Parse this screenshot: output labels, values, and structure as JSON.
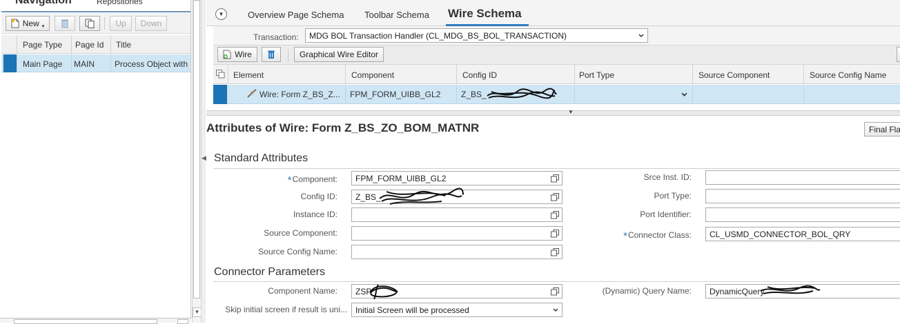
{
  "navigation": {
    "title": "Navigation",
    "repositories_tab": "Repositories",
    "toolbar": {
      "new": "New",
      "up": "Up",
      "down": "Down"
    },
    "columns": [
      "Page Type",
      "Page Id",
      "Title"
    ],
    "rows": [
      {
        "page_type": "Main Page",
        "page_id": "MAIN",
        "title": "Process Object with"
      }
    ]
  },
  "tabs": {
    "overview": "Overview Page Schema",
    "toolbar": "Toolbar Schema",
    "wire": "Wire Schema"
  },
  "transaction": {
    "label": "Transaction:",
    "value": "MDG BOL Transaction Handler (CL_MDG_BS_BOL_TRANSACTION)"
  },
  "wire_toolbar": {
    "wire": "Wire",
    "editor": "Graphical Wire Editor"
  },
  "wire_grid": {
    "columns": [
      "Element",
      "Component",
      "Config ID",
      "Port Type",
      "Source Component",
      "Source Config Name"
    ],
    "rows": [
      {
        "element": "Wire: Form Z_BS_Z...",
        "component": "FPM_FORM_UIBB_GL2",
        "config_id": "Z_BS_",
        "port_type": "",
        "source_component": "",
        "source_config_name": ""
      }
    ]
  },
  "attributes": {
    "title": "Attributes of Wire: Form Z_BS_ZO_BOM_MATNR",
    "final_flag_button": "Final Fla",
    "standard": {
      "title": "Standard Attributes",
      "component_label": "Component:",
      "component_value": "FPM_FORM_UIBB_GL2",
      "config_id_label": "Config ID:",
      "config_id_value": "Z_BS_",
      "instance_id_label": "Instance ID:",
      "instance_id_value": "",
      "source_component_label": "Source Component:",
      "source_component_value": "",
      "source_config_name_label": "Source Config Name:",
      "source_config_name_value": "",
      "srce_inst_label": "Srce Inst. ID:",
      "srce_inst_value": "",
      "port_type_label": "Port Type:",
      "port_type_value": "",
      "port_identifier_label": "Port Identifier:",
      "port_identifier_value": "",
      "connector_class_label": "Connector Class:",
      "connector_class_value": "CL_USMD_CONNECTOR_BOL_QRY"
    },
    "connector": {
      "title": "Connector Parameters",
      "component_name_label": "Component Name:",
      "component_name_value": "ZSP",
      "skip_label": "Skip initial screen if result is uni...",
      "skip_value": "Initial Screen will be processed",
      "query_name_label": "(Dynamic) Query Name:",
      "query_name_value": "DynamicQuery"
    }
  },
  "colors": {
    "selection": "#cfe6f5",
    "accent": "#2f7dc0",
    "selected_marker": "#1b74b6"
  },
  "icons": [
    "new-page-icon",
    "delete-icon",
    "copy-icon",
    "wire-icon",
    "trash-icon",
    "dropdown-arrow-icon",
    "open-field-icon",
    "menu-circle-icon"
  ]
}
